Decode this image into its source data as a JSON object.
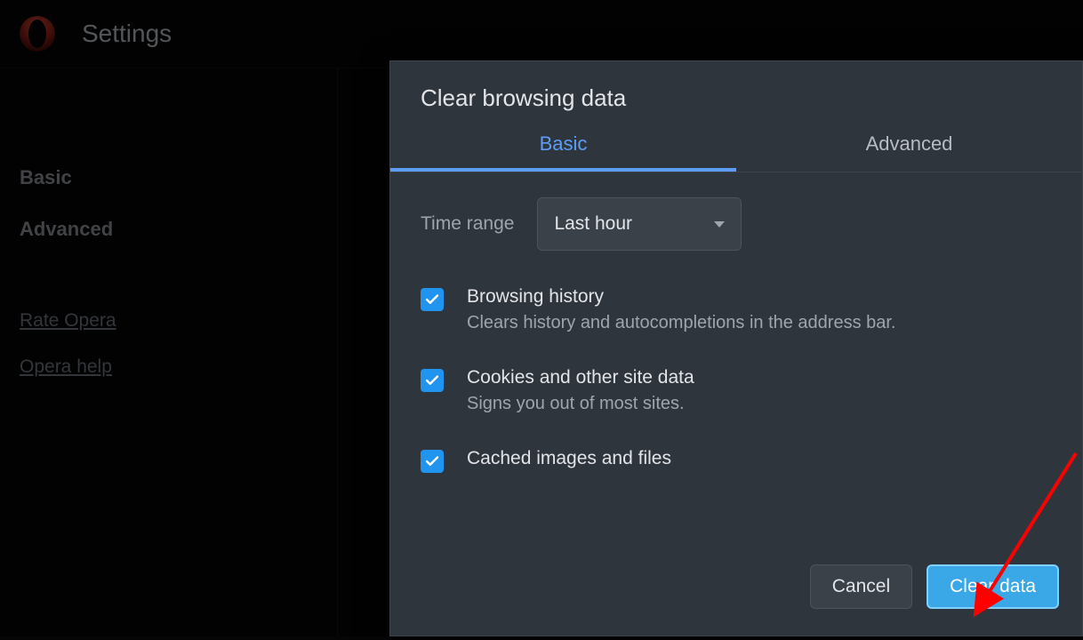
{
  "header": {
    "title": "Settings"
  },
  "sidebar": {
    "basic_label": "Basic",
    "advanced_label": "Advanced",
    "rate_label": "Rate Opera",
    "help_label": "Opera help"
  },
  "dialog": {
    "title": "Clear browsing data",
    "tabs": {
      "basic": "Basic",
      "advanced": "Advanced"
    },
    "time_range": {
      "label": "Time range",
      "value": "Last hour"
    },
    "items": [
      {
        "title": "Browsing history",
        "desc": "Clears history and autocompletions in the address bar."
      },
      {
        "title": "Cookies and other site data",
        "desc": "Signs you out of most sites."
      },
      {
        "title": "Cached images and files",
        "desc": ""
      }
    ],
    "buttons": {
      "cancel": "Cancel",
      "clear": "Clear data"
    }
  },
  "colors": {
    "accent_blue": "#5c9df7",
    "checkbox_blue": "#2094ef",
    "primary_btn": "#3aa7e6"
  }
}
